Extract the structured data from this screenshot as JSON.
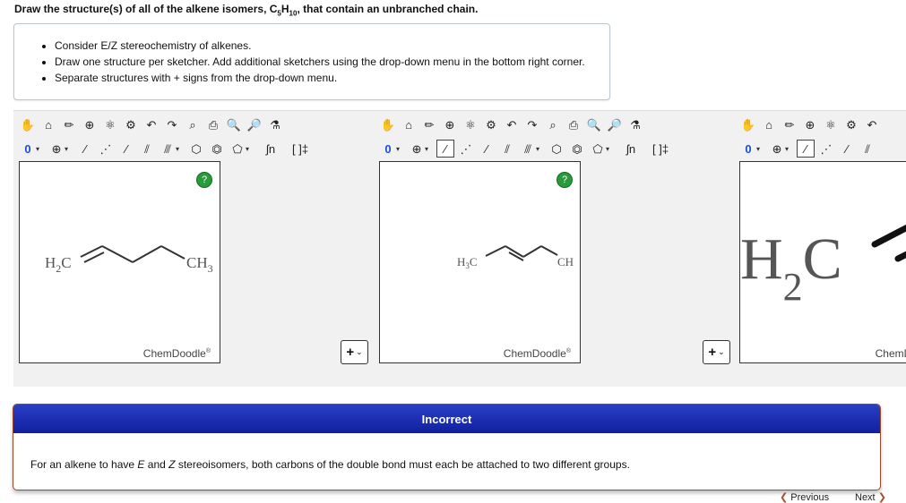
{
  "question": {
    "prefix": "Draw the structure(s) of all of the alkene isomers, C",
    "sub1": "5",
    "mid": "H",
    "sub2": "10",
    "suffix": ", that contain an unbranched chain."
  },
  "instructions": [
    "Consider E/Z stereochemistry of alkenes.",
    "Draw one structure per sketcher. Add additional sketchers using the drop-down menu in the bottom right corner.",
    "Separate structures with + signs from the drop-down menu."
  ],
  "toolbar": {
    "row1": [
      "✋",
      "⌂",
      "✏",
      "⊕",
      "⚛",
      "⚙",
      "↶",
      "↷",
      "⌕",
      "⎙",
      "🔍",
      "🔎",
      "⚗"
    ],
    "charge": "0",
    "add": "⊕",
    "dropdown": "▾",
    "bonds": [
      "∕",
      "⋰",
      "⁄",
      "⫽",
      "⫻"
    ],
    "rings": [
      "⬡",
      "⏣",
      "⬠"
    ],
    "extra": [
      "ʃn",
      "[ ]‡"
    ]
  },
  "sketchers": [
    {
      "help": "?",
      "brand": "ChemDoodle",
      "brand_mark": "®",
      "labels": {
        "left_main": "H",
        "left_sub": "2",
        "left_tail": "C",
        "right": "CH",
        "right_sub": "3"
      }
    },
    {
      "help": "?",
      "brand": "ChemDoodle",
      "brand_mark": "®",
      "labels": {
        "left_main": "H",
        "left_sub": "3",
        "left_tail": "C",
        "right": "CH"
      }
    },
    {
      "brand": "ChemDo",
      "labels": {
        "left_main": "H",
        "left_sub": "2",
        "left_tail": "C"
      }
    }
  ],
  "plus_button": {
    "symbol": "+",
    "chevron": "⌄"
  },
  "feedback": {
    "title": "Incorrect",
    "body_a": "For an alkene to have ",
    "E": "E",
    "body_b": " and ",
    "Z": "Z",
    "body_c": " stereoisomers, both carbons of the double bond must each be attached to two different groups."
  },
  "nav": {
    "previous": "Previous",
    "next": "Next",
    "prev_chevron": "❮",
    "next_chevron": "❯"
  }
}
